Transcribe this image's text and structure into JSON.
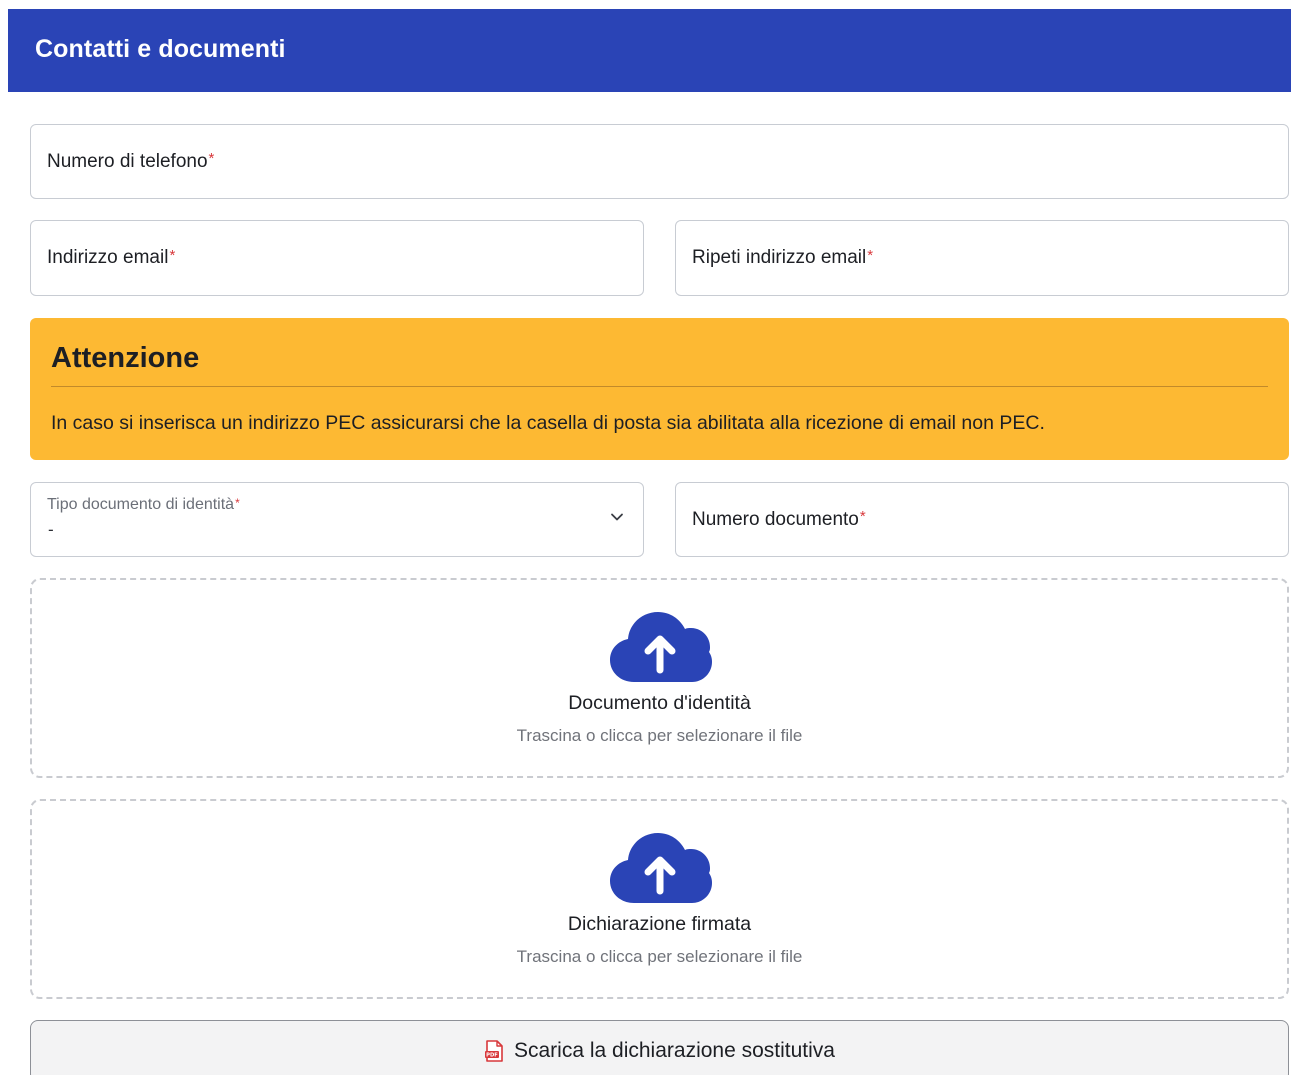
{
  "header": {
    "title": "Contatti e documenti"
  },
  "form": {
    "phone_label": "Numero di telefono",
    "email_label": "Indirizzo email",
    "email_repeat_label": "Ripeti indirizzo email",
    "required_marker": "*",
    "doc_type_label": "Tipo documento di identità",
    "doc_type_value": "-",
    "doc_number_label": "Numero documento"
  },
  "alert": {
    "title": "Attenzione",
    "text": "In caso si inserisca un indirizzo PEC assicurarsi che la casella di posta sia abilitata alla ricezione di email non PEC."
  },
  "uploads": [
    {
      "title": "Documento d'identità",
      "hint": "Trascina o clicca per selezionare il file",
      "icon": "cloud-upload-icon"
    },
    {
      "title": "Dichiarazione firmata",
      "hint": "Trascina o clicca per selezionare il file",
      "icon": "cloud-upload-icon"
    }
  ],
  "download": {
    "label": "Scarica la dichiarazione sostitutiva",
    "icon": "pdf-file-icon"
  },
  "colors": {
    "header_bg": "#2a44b6",
    "alert_bg": "#fdb933",
    "required": "#d8383b",
    "icon_blue": "#2a44b6",
    "pdf_red": "#d8383b"
  }
}
